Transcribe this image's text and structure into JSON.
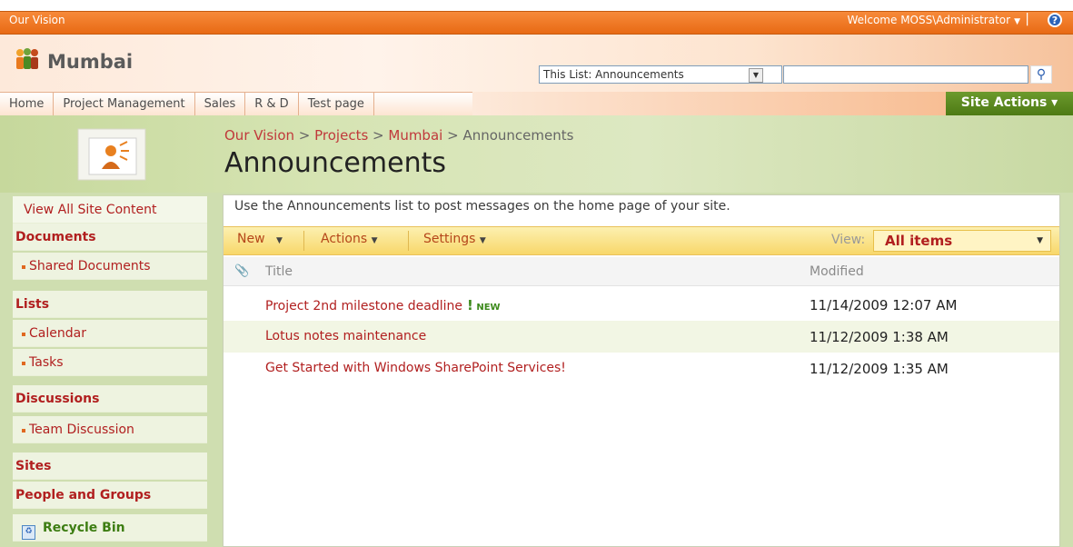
{
  "topbar": {
    "site_name": "Our Vision",
    "welcome": "Welcome MOSS\\Administrator",
    "separator": "|",
    "help_glyph": "?"
  },
  "header": {
    "title": "Mumbai",
    "scope_value": "This List: Announcements",
    "search_value": "",
    "search_glyph": "⚲"
  },
  "tabs": [
    {
      "label": "Home"
    },
    {
      "label": "Project Management"
    },
    {
      "label": "Sales"
    },
    {
      "label": "R & D"
    },
    {
      "label": "Test page"
    }
  ],
  "site_actions": {
    "label": "Site Actions ▾"
  },
  "breadcrumb": {
    "items": [
      "Our Vision",
      "Projects",
      "Mumbai",
      "Announcements"
    ],
    "sep": " > "
  },
  "page": {
    "title": "Announcements",
    "description": "Use the Announcements list to post messages on the home page of your site."
  },
  "leftnav": {
    "view_all": "View All Site Content",
    "sections": [
      {
        "heading": "Documents",
        "items": [
          "Shared Documents"
        ]
      },
      {
        "heading": "Lists",
        "items": [
          "Calendar",
          "Tasks"
        ]
      },
      {
        "heading": "Discussions",
        "items": [
          "Team Discussion"
        ]
      },
      {
        "heading": "Sites",
        "items": []
      },
      {
        "heading": "People and Groups",
        "items": []
      }
    ],
    "recycle_bin": "Recycle Bin"
  },
  "toolbar": {
    "new_label": "New",
    "actions_label": "Actions",
    "settings_label": "Settings",
    "view_label": "View:",
    "view_value": "All items"
  },
  "list": {
    "columns": {
      "title": "Title",
      "modified": "Modified"
    },
    "rows": [
      {
        "title": "Project 2nd milestone deadline",
        "is_new": true,
        "new_label": "NEW",
        "modified": "11/14/2009 12:07 AM"
      },
      {
        "title": "Lotus notes maintenance",
        "is_new": false,
        "modified": "11/12/2009 1:38 AM"
      },
      {
        "title": "Get Started with Windows SharePoint Services!",
        "is_new": false,
        "modified": "11/12/2009 1:35 AM"
      }
    ]
  },
  "colors": {
    "top_bar": "#e86a14",
    "site_actions": "#4d7a14",
    "link_red": "#b11f1f",
    "nav_green": "#cfdeb0",
    "toolbar_yellow": "#f8d76a"
  }
}
